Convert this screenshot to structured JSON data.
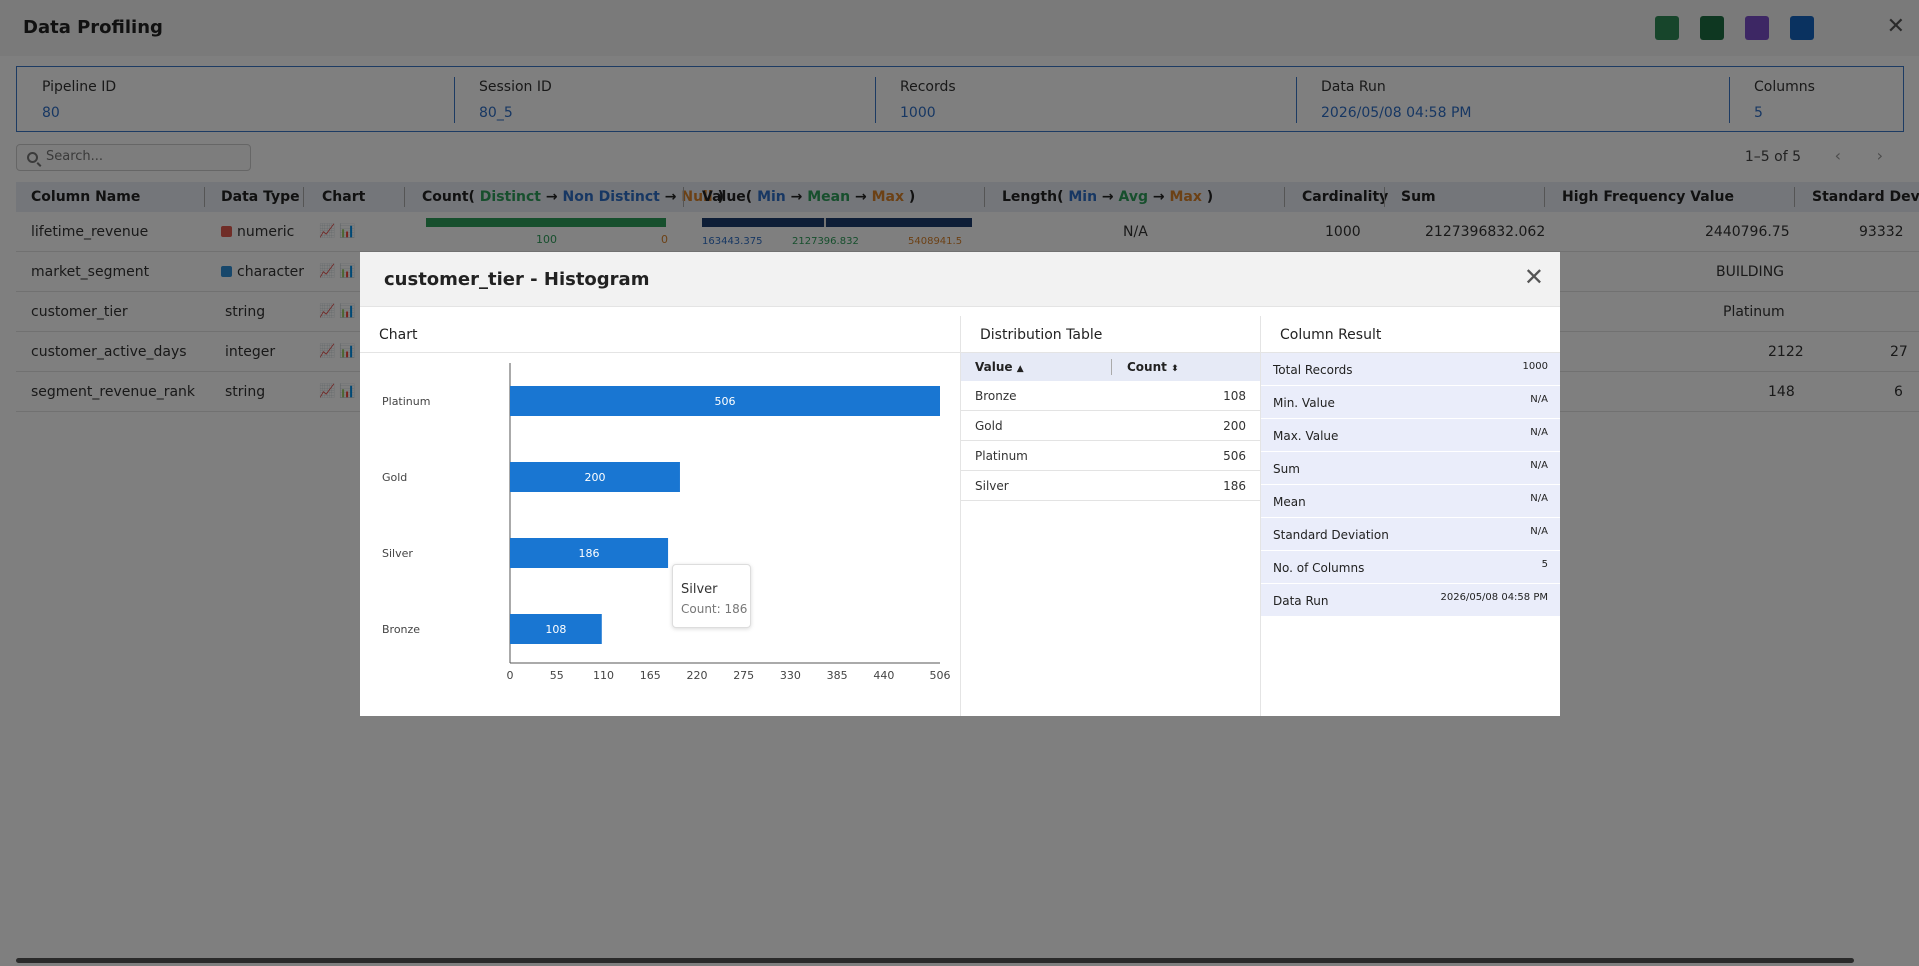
{
  "page": {
    "title": "Data Profiling",
    "top_icons": [
      "csv-export-icon",
      "excel-export-icon",
      "pdf-export-icon",
      "email-icon"
    ]
  },
  "info": [
    {
      "label": "Pipeline ID",
      "value": "80"
    },
    {
      "label": "Session ID",
      "value": "80_5"
    },
    {
      "label": "Records",
      "value": "1000"
    },
    {
      "label": "Data Run",
      "value": "2026/05/08 04:58 PM"
    },
    {
      "label": "Columns",
      "value": "5"
    }
  ],
  "search": {
    "placeholder": "Search..."
  },
  "pagination": {
    "text": "1–5 of 5",
    "prev": "‹",
    "next": "›"
  },
  "table": {
    "headers": {
      "column_name": "Column Name",
      "data_type": "Data Type",
      "chart": "Chart",
      "count_prefix": "Count(",
      "count_distinct": "Distinct",
      "count_non_distinct": "Non Distinct",
      "count_null": "Null",
      "value_prefix": "Value(",
      "value_min": "Min",
      "value_mean": "Mean",
      "value_max": "Max",
      "length_prefix": "Length(",
      "length_min": "Min",
      "length_avg": "Avg",
      "length_max": "Max",
      "arrow": "→",
      "close_paren": ")",
      "cardinality": "Cardinality",
      "sum": "Sum",
      "high_freq": "High Frequency Value",
      "std_dev": "Standard Devia"
    },
    "rows": [
      {
        "name": "lifetime_revenue",
        "dtype": "numeric",
        "dtype_icon_color": "#e05a4f",
        "count_distinct": "100",
        "count_null": "0",
        "count_distinct_fraction": 1.0,
        "value_min": "163443.375",
        "value_mean": "2127396.832",
        "value_max": "5408941.5",
        "value_mean_fraction": 0.45,
        "length": "N/A",
        "cardinality": "1000",
        "sum": "2127396832.062",
        "high_freq": "2440796.75",
        "std_dev": "93332"
      },
      {
        "name": "market_segment",
        "dtype": "character",
        "dtype_icon_color": "#2f8fd6",
        "high_freq": "BUILDING"
      },
      {
        "name": "customer_tier",
        "dtype": "string",
        "high_freq": "Platinum"
      },
      {
        "name": "customer_active_days",
        "dtype": "integer",
        "high_freq": "2122",
        "std_dev": "27"
      },
      {
        "name": "segment_revenue_rank",
        "dtype": "string",
        "high_freq": "148",
        "std_dev": "6"
      }
    ]
  },
  "modal": {
    "title": "customer_tier - Histogram",
    "panels": {
      "chart": "Chart",
      "distribution": "Distribution Table",
      "result": "Column Result"
    },
    "distribution": {
      "header_value": "Value",
      "header_count": "Count",
      "rows": [
        {
          "value": "Bronze",
          "count": "108"
        },
        {
          "value": "Gold",
          "count": "200"
        },
        {
          "value": "Platinum",
          "count": "506"
        },
        {
          "value": "Silver",
          "count": "186"
        }
      ]
    },
    "result": [
      {
        "key": "Total Records",
        "value": "1000"
      },
      {
        "key": "Min. Value",
        "value": "N/A"
      },
      {
        "key": "Max. Value",
        "value": "N/A"
      },
      {
        "key": "Sum",
        "value": "N/A"
      },
      {
        "key": "Mean",
        "value": "N/A"
      },
      {
        "key": "Standard Deviation",
        "value": "N/A"
      },
      {
        "key": "No. of Columns",
        "value": "5"
      },
      {
        "key": "Data Run",
        "value": "2026/05/08 04:58 PM"
      }
    ],
    "tooltip": {
      "title": "Silver",
      "count": "Count: 186"
    }
  },
  "chart_data": {
    "type": "bar",
    "orientation": "horizontal",
    "categories": [
      "Platinum",
      "Gold",
      "Silver",
      "Bronze"
    ],
    "values": [
      506,
      200,
      186,
      108
    ],
    "xticks": [
      "0",
      "55",
      "110",
      "165",
      "220",
      "275",
      "330",
      "385",
      "440",
      "506"
    ],
    "xlim": [
      0,
      506
    ],
    "bar_color": "#1976d2",
    "title": "",
    "xlabel": "",
    "ylabel": ""
  }
}
